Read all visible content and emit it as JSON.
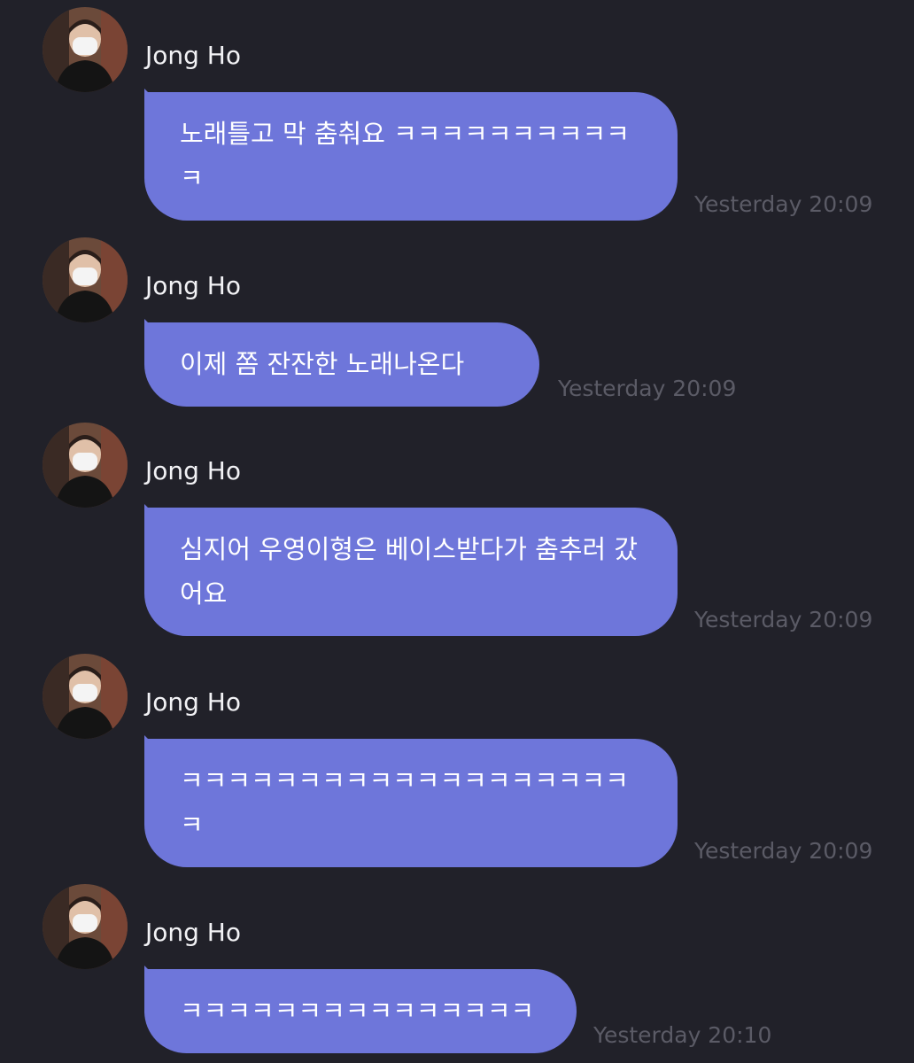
{
  "chat": {
    "messages": [
      {
        "sender": "Jong Ho",
        "avatar_icon": "profile-photo-masked-person",
        "text": "노래틀고 막 춤춰요 ㅋㅋㅋㅋㅋㅋㅋㅋㅋㅋㅋ",
        "timestamp": "Yesterday 20:09"
      },
      {
        "sender": "Jong Ho",
        "avatar_icon": "profile-photo-masked-person",
        "text": "이제 쫌 잔잔한 노래나온다",
        "timestamp": "Yesterday 20:09"
      },
      {
        "sender": "Jong Ho",
        "avatar_icon": "profile-photo-masked-person",
        "text": "심지어 우영이형은 베이스받다가 춤추러 갔어요",
        "timestamp": "Yesterday 20:09"
      },
      {
        "sender": "Jong Ho",
        "avatar_icon": "profile-photo-masked-person",
        "text": "ㅋㅋㅋㅋㅋㅋㅋㅋㅋㅋㅋㅋㅋㅋㅋㅋㅋㅋㅋㅋ",
        "timestamp": "Yesterday 20:09"
      },
      {
        "sender": "Jong Ho",
        "avatar_icon": "profile-photo-masked-person",
        "text": "ㅋㅋㅋㅋㅋㅋㅋㅋㅋㅋㅋㅋㅋㅋㅋ",
        "timestamp": "Yesterday 20:10"
      }
    ]
  },
  "colors": {
    "background": "#212129",
    "bubble": "#6e76da",
    "sender_text": "#f2f2f5",
    "timestamp_text": "#5b5b66"
  }
}
